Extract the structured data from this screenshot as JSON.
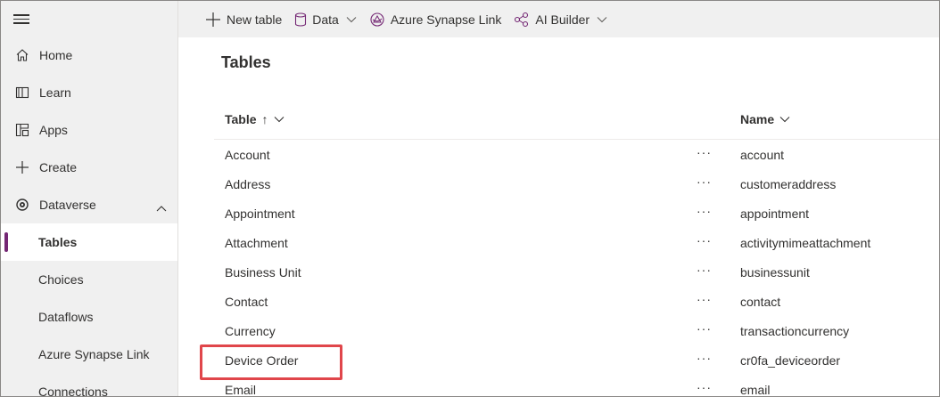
{
  "topbar": {
    "items": [
      {
        "label": "New table",
        "icon": "plus-icon"
      },
      {
        "label": "Data",
        "icon": "database-icon",
        "dropdown": true
      },
      {
        "label": "Azure Synapse Link",
        "icon": "synapse-icon"
      },
      {
        "label": "AI Builder",
        "icon": "ai-builder-icon",
        "dropdown": true
      }
    ]
  },
  "sidebar": {
    "items": [
      {
        "label": "Home",
        "icon": "home-icon"
      },
      {
        "label": "Learn",
        "icon": "book-icon"
      },
      {
        "label": "Apps",
        "icon": "apps-icon"
      },
      {
        "label": "Create",
        "icon": "plus-icon"
      },
      {
        "label": "Dataverse",
        "icon": "dataverse-icon",
        "expanded": true
      },
      {
        "label": "Tables",
        "selected": true
      },
      {
        "label": "Choices"
      },
      {
        "label": "Dataflows"
      },
      {
        "label": "Azure Synapse Link"
      },
      {
        "label": "Connections"
      }
    ]
  },
  "main": {
    "title": "Tables",
    "columns": {
      "table": "Table",
      "sort_arrow": "↑",
      "name": "Name"
    },
    "more_label": "···",
    "rows": [
      {
        "table": "Account",
        "name": "account"
      },
      {
        "table": "Address",
        "name": "customeraddress"
      },
      {
        "table": "Appointment",
        "name": "appointment"
      },
      {
        "table": "Attachment",
        "name": "activitymimeattachment"
      },
      {
        "table": "Business Unit",
        "name": "businessunit"
      },
      {
        "table": "Contact",
        "name": "contact"
      },
      {
        "table": "Currency",
        "name": "transactioncurrency"
      },
      {
        "table": "Device Order",
        "name": "cr0fa_deviceorder"
      },
      {
        "table": "Email",
        "name": "email"
      }
    ]
  },
  "colors": {
    "accent": "#742774",
    "highlight": "#e0464b"
  }
}
